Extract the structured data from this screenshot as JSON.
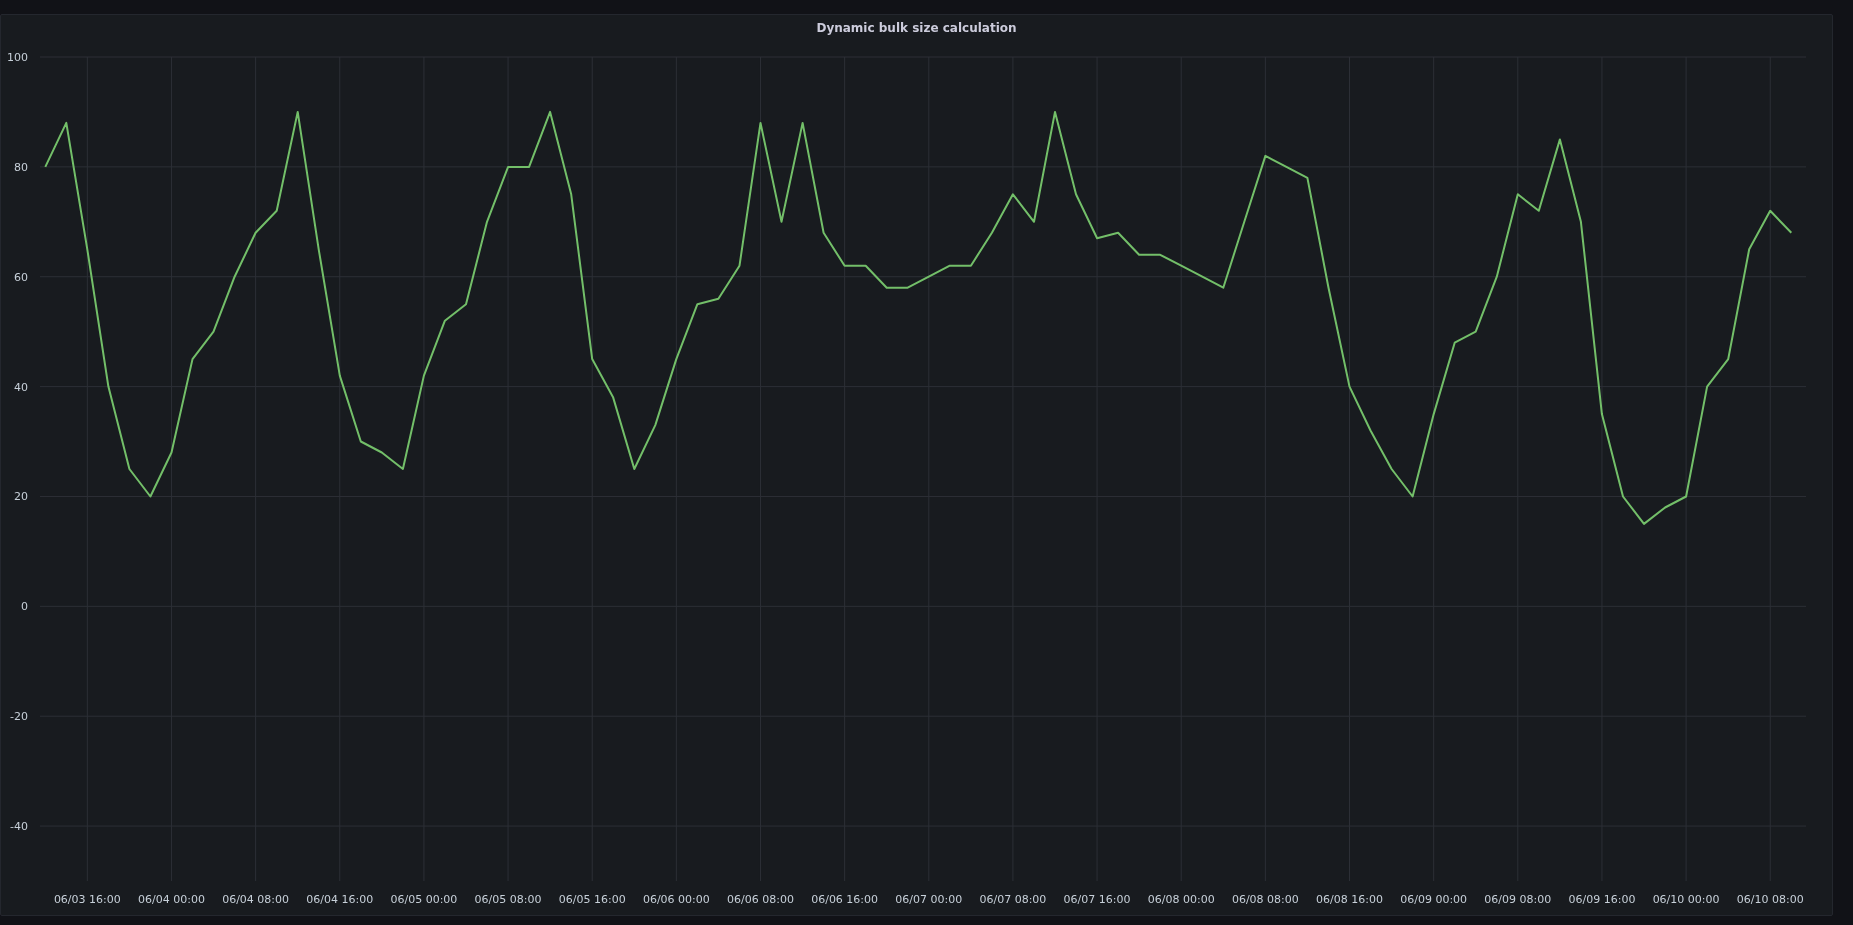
{
  "panel": {
    "title": "Dynamic bulk size calculation",
    "chart_data": {
      "type": "line",
      "categories": [
        null,
        null,
        "06/03 16:00",
        null,
        null,
        null,
        "06/04 00:00",
        null,
        null,
        null,
        "06/04 08:00",
        null,
        null,
        null,
        "06/04 16:00",
        null,
        null,
        null,
        "06/05 00:00",
        null,
        null,
        null,
        "06/05 08:00",
        null,
        null,
        null,
        "06/05 16:00",
        null,
        null,
        null,
        "06/06 00:00",
        null,
        null,
        null,
        "06/06 08:00",
        null,
        null,
        null,
        "06/06 16:00",
        null,
        null,
        null,
        "06/07 00:00",
        null,
        null,
        null,
        "06/07 08:00",
        null,
        null,
        null,
        "06/07 16:00",
        null,
        null,
        null,
        "06/08 00:00",
        null,
        null,
        null,
        "06/08 08:00",
        null,
        null,
        null,
        "06/08 16:00",
        null,
        null,
        null,
        "06/09 00:00",
        null,
        null,
        null,
        "06/09 08:00",
        null,
        null,
        null,
        "06/09 16:00",
        null,
        null,
        null,
        "06/10 00:00",
        null,
        null,
        null,
        "06/10 08:00",
        null
      ],
      "series": [
        {
          "color": "#73bf69",
          "values": [
            80,
            88,
            65,
            40,
            25,
            20,
            28,
            45,
            50,
            60,
            68,
            72,
            90,
            65,
            42,
            30,
            28,
            25,
            42,
            52,
            55,
            70,
            80,
            80,
            90,
            75,
            45,
            38,
            25,
            33,
            45,
            55,
            56,
            62,
            88,
            70,
            88,
            68,
            62,
            62,
            58,
            58,
            60,
            62,
            62,
            68,
            75,
            70,
            90,
            75,
            67,
            68,
            64,
            64,
            62,
            60,
            58,
            70,
            82,
            80,
            78,
            58,
            40,
            32,
            25,
            20,
            35,
            48,
            50,
            60,
            75,
            72,
            85,
            70,
            35,
            20,
            15,
            18,
            20,
            40,
            45,
            65,
            72,
            68
          ]
        }
      ],
      "grid": true,
      "ylim": [
        -50,
        100
      ],
      "yticks": [
        -40,
        -20,
        0,
        20,
        40,
        60,
        80,
        100
      ]
    }
  }
}
